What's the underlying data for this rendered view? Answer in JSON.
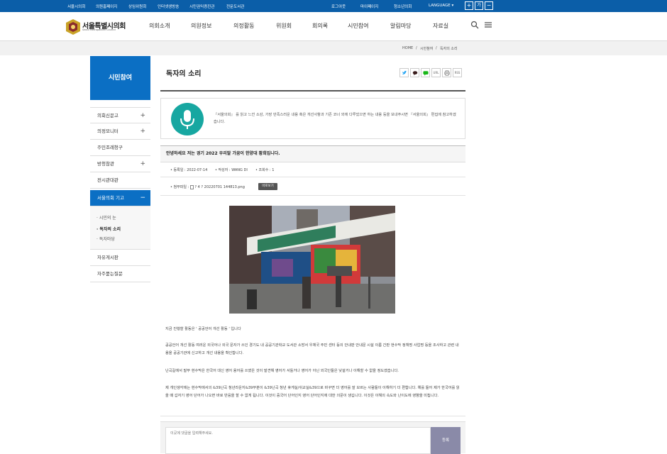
{
  "topbar": {
    "links": [
      "서울시의회",
      "의원홈페이지",
      "상임위원회",
      "인터넷생방송",
      "시민권익증진관",
      "전문도서관"
    ],
    "right_links": [
      "로그아웃",
      "마이페이지",
      "청소년의회"
    ],
    "language": "LANGUAGE",
    "zoom_in": "+",
    "zoom_reset": "가",
    "zoom_out": "−"
  },
  "header": {
    "logo_title": "서울특별시의회",
    "logo_sub": "Seoul Metropolitan Council",
    "menu": [
      "의회소개",
      "의원정보",
      "의정활동",
      "위원회",
      "회의록",
      "시민참여",
      "알림마당",
      "자료실"
    ],
    "search_icon": "search-icon",
    "menu_icon": "hamburger-icon"
  },
  "breadcrumb": [
    "HOME",
    "/",
    "시민참여",
    "/",
    "독자의 소리"
  ],
  "sidebar": {
    "title": "시민참여",
    "items": [
      {
        "label": "의회신문고",
        "plus": "+"
      },
      {
        "label": "의정모니터",
        "plus": "+"
      },
      {
        "label": "주민조례청구",
        "plus": ""
      },
      {
        "label": "방청참관",
        "plus": "+"
      },
      {
        "label": "전시관대관",
        "plus": ""
      },
      {
        "label": "서울의회 기고",
        "plus": "−"
      }
    ],
    "sub_items": [
      "· 시민의 눈",
      "· 독자의 소리",
      "· 독자마당"
    ],
    "bottom_items": [
      "자유게시판",
      "자주묻는질문"
    ]
  },
  "content": {
    "title": "독자의 소리",
    "share": [
      "twitter-icon",
      "kakao-icon",
      "line-icon",
      "URL",
      "print-icon",
      "RSS"
    ],
    "share_labels": {
      "url": "URL",
      "rss": "RSS"
    },
    "info_text": "『서울의회』 를 읽고 느낀 소감, 가장 만족스러운 내용 혹은 개선사항과 기존 코너 외에 다루었으면 하는 내용 등을 보내주시면 『서울의회』 편집에 참고하겠습니다.",
    "post_title": "안녕하세요 저는 경기 2022 우리말 가꿈이 한양대 황희입니다.",
    "meta": {
      "date_label": "• 등록일 : 2022-07-14",
      "author_label": "• 작성자 : WANG DI",
      "views_label": "• 조회수 : 1"
    },
    "attach_label": "• 첨부파일 :",
    "attach_file": "? 4 ? 20220701 144813.png",
    "view_button": "바로보기",
    "paragraphs": [
      "지금   진행할 활동은 ' 공공언어 개선   활동 '   입니다",
      "공공언어 개선 활동 여러운 외국어나 외국 문자가 쓰인 경기도 내 공공기관학교 도서관 소방서 우체국 주민 센터 등의 안내판 안내문 시설 이름 간판 현수막 정책명 사업명 등을 조사하고 관련 내용을 공공기관에 신고하고 개선 내용을 확인합니다.",
      "난곡길에서 말부 현수막은 한국어 대신 영어 용어를 쓰였은 것이 발견해 영어가 서툴거나 영어가 아닌 외국인들은 낯설거나 이해할 수 없을 정도였습니다.",
      "제 개인생각에는 현수막에서의 &39난곡 청년라운지&39부분이 &39난곡 청년 휴게실/쉬교실&39으로 바꾸면 더 영어를 잘 모르는 사람들이 이해하기 더 편합니다. 예를 들어 제가 한국어를 읽을 때 갑자기 영어 단어가 나오면 바로 반응을 할 수 없게 됩니다. 이것이 중국어 단어인지 영어 단어인지에 대한 의문이 생깁니다. 이것은 이해의 속도와 난이도에 영향을 미칩니다."
    ]
  },
  "comment": {
    "placeholder": "이곳에 댓글을 입력해주세요.",
    "submit": "등록"
  },
  "colors": {
    "topbar": "#0b5ea8",
    "sidebar_active": "#0b6fc4",
    "mic_circle": "#17a7a1",
    "comment_button": "#8a8aa8"
  }
}
